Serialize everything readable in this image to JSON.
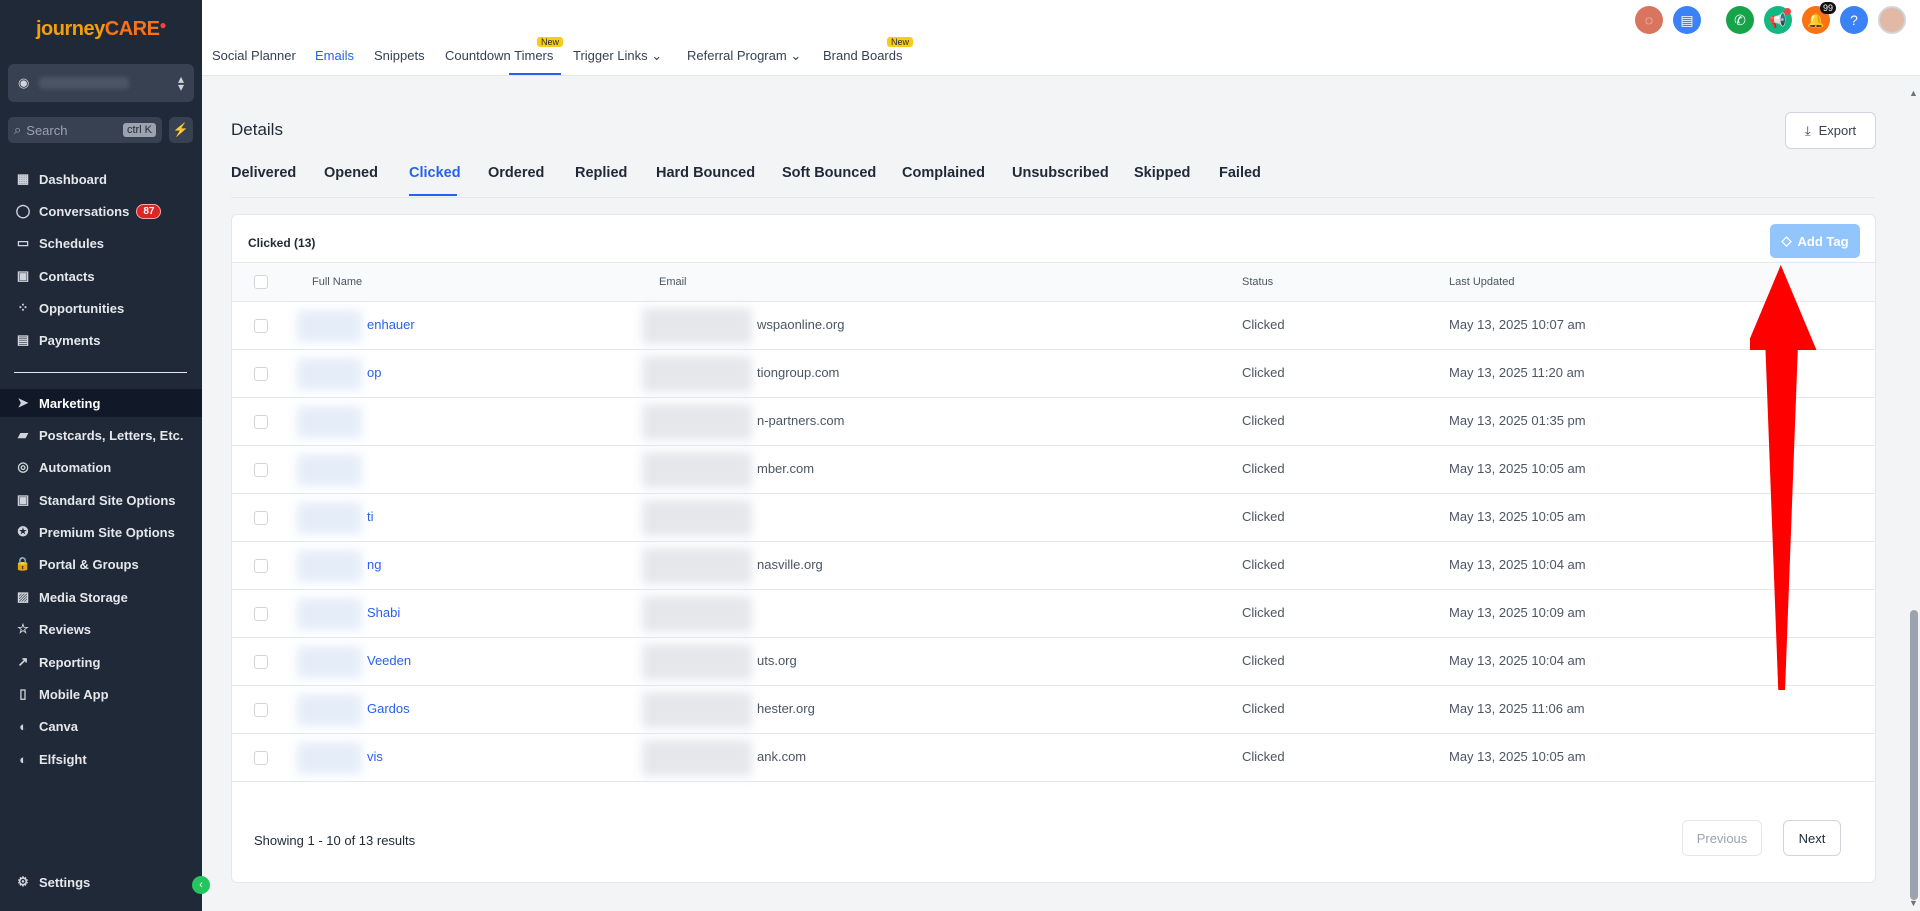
{
  "app": {
    "logo_main": "journey",
    "logo_care": "CARE"
  },
  "sidebar": {
    "search_placeholder": "Search",
    "search_shortcut": "ctrl K",
    "items": [
      {
        "label": "Dashboard",
        "icon": "dashboard-icon"
      },
      {
        "label": "Conversations",
        "icon": "chat-icon",
        "badge": "87"
      },
      {
        "label": "Schedules",
        "icon": "calendar-icon"
      },
      {
        "label": "Contacts",
        "icon": "contacts-icon"
      },
      {
        "label": "Opportunities",
        "icon": "opportunities-icon"
      },
      {
        "label": "Payments",
        "icon": "payments-icon"
      },
      {
        "label": "Marketing",
        "icon": "send-icon",
        "active": true
      },
      {
        "label": "Postcards, Letters, Etc.",
        "icon": "postcard-icon"
      },
      {
        "label": "Automation",
        "icon": "automation-icon"
      },
      {
        "label": "Standard Site Options",
        "icon": "site-icon"
      },
      {
        "label": "Premium Site Options",
        "icon": "award-icon"
      },
      {
        "label": "Portal & Groups",
        "icon": "lock-icon"
      },
      {
        "label": "Media Storage",
        "icon": "image-icon"
      },
      {
        "label": "Reviews",
        "icon": "star-icon"
      },
      {
        "label": "Reporting",
        "icon": "trend-icon"
      },
      {
        "label": "Mobile App",
        "icon": "mobile-icon"
      },
      {
        "label": "Canva",
        "icon": "palette-icon"
      },
      {
        "label": "Elfsight",
        "icon": "palette-icon"
      }
    ],
    "settings_label": "Settings"
  },
  "topnav": {
    "tabs": [
      "Social Planner",
      "Emails",
      "Snippets",
      "Countdown Timers",
      "Trigger Links",
      "Referral Program",
      "Brand Boards"
    ],
    "new_label": "New",
    "notif_count": "99"
  },
  "details": {
    "title": "Details",
    "export_label": "Export",
    "subtabs": [
      "Delivered",
      "Opened",
      "Clicked",
      "Ordered",
      "Replied",
      "Hard Bounced",
      "Soft Bounced",
      "Complained",
      "Unsubscribed",
      "Skipped",
      "Failed"
    ],
    "active_subtab": "Clicked",
    "table_title": "Clicked (13)",
    "add_tag_label": "Add Tag",
    "columns": [
      "Full Name",
      "Email",
      "Status",
      "Last Updated"
    ],
    "rows": [
      {
        "name": "enhauer",
        "email": "wspaonline.org",
        "status": "Clicked",
        "updated": "May 13, 2025 10:07 am"
      },
      {
        "name": "op",
        "email": "tiongroup.com",
        "status": "Clicked",
        "updated": "May 13, 2025 11:20 am"
      },
      {
        "name": "",
        "email": "n-partners.com",
        "status": "Clicked",
        "updated": "May 13, 2025 01:35 pm"
      },
      {
        "name": "",
        "email": "mber.com",
        "status": "Clicked",
        "updated": "May 13, 2025 10:05 am"
      },
      {
        "name": "ti",
        "email": "",
        "status": "Clicked",
        "updated": "May 13, 2025 10:05 am"
      },
      {
        "name": "ng",
        "email": "nasville.org",
        "status": "Clicked",
        "updated": "May 13, 2025 10:04 am"
      },
      {
        "name": "Shabi",
        "email": "",
        "status": "Clicked",
        "updated": "May 13, 2025 10:09 am"
      },
      {
        "name": "Veeden",
        "email": "uts.org",
        "status": "Clicked",
        "updated": "May 13, 2025 10:04 am"
      },
      {
        "name": "Gardos",
        "email": "hester.org",
        "status": "Clicked",
        "updated": "May 13, 2025 11:06 am"
      },
      {
        "name": "vis",
        "email": "ank.com",
        "status": "Clicked",
        "updated": "May 13, 2025 10:05 am"
      }
    ],
    "showing": "Showing 1 - 10 of 13 results",
    "prev_label": "Previous",
    "next_label": "Next"
  },
  "colors": {
    "accent": "#2563eb",
    "sidebar": "#1f2937",
    "annotation_arrow": "#ff0000"
  }
}
